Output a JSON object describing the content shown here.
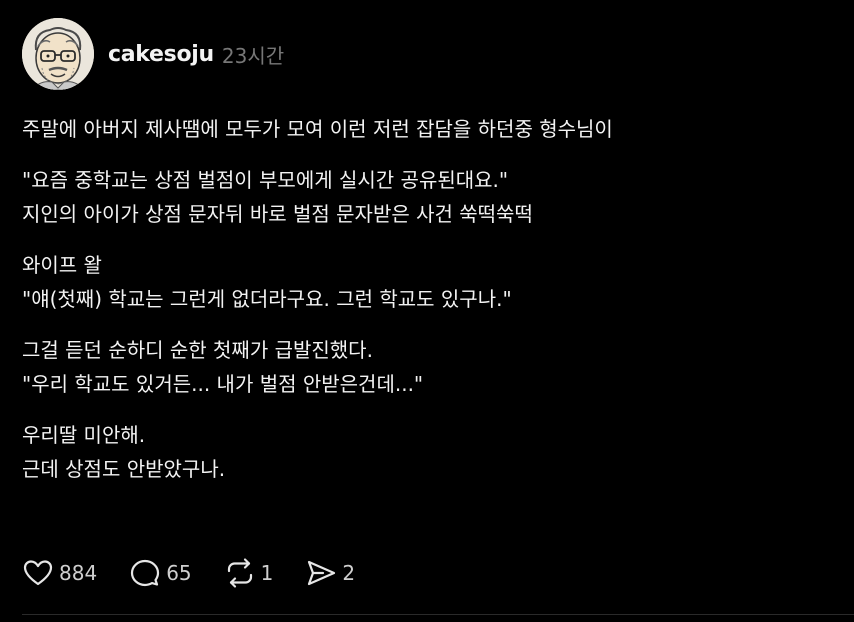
{
  "post": {
    "username": "cakesoju",
    "timestamp": "23시간",
    "paragraphs": [
      {
        "lines": [
          "주말에 아버지 제사땜에 모두가 모여 이런 저런 잡담을 하던중 형수님이"
        ]
      },
      {
        "lines": [
          "\"요즘 중학교는 상점 벌점이 부모에게 실시간 공유된대요.\"",
          "지인의 아이가 상점 문자뒤 바로 벌점 문자받은 사건 쑥떡쑥떡"
        ]
      },
      {
        "lines": [
          "와이프 왈",
          "\"얘(첫째) 학교는 그런게 없더라구요. 그런 학교도 있구나.\""
        ]
      },
      {
        "lines": [
          "그걸 듣던 순하디 순한 첫째가 급발진했다.",
          "\"우리 학교도 있거든... 내가 벌점 안받은건데...\""
        ]
      },
      {
        "lines": [
          "우리딸 미안해.",
          "근데 상점도 안받았구나."
        ]
      }
    ]
  },
  "actions": {
    "like": {
      "icon": "heart-icon",
      "count": "884"
    },
    "comment": {
      "icon": "comment-bubble-icon",
      "count": "65"
    },
    "repost": {
      "icon": "repost-icon",
      "count": "1"
    },
    "share": {
      "icon": "send-icon",
      "count": "2"
    }
  },
  "colors": {
    "background": "#000000",
    "text": "#f3f3f3",
    "muted": "#777777"
  }
}
